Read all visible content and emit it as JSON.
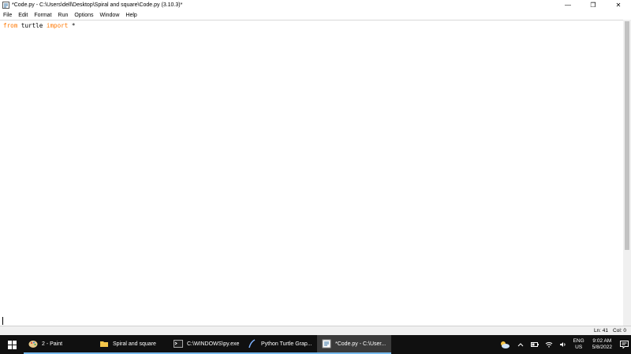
{
  "window": {
    "title": "*Code.py - C:\\Users\\dell\\Desktop\\Spiral and square\\Code.py (3.10.3)*",
    "controls": {
      "minimize": "—",
      "maximize": "❐",
      "close": "✕"
    }
  },
  "menu": [
    "File",
    "Edit",
    "Format",
    "Run",
    "Options",
    "Window",
    "Help"
  ],
  "editor": {
    "line1": {
      "kw1": "from",
      "t1": " turtle ",
      "kw2": "import",
      "t2": " *"
    }
  },
  "status": {
    "line": "Ln: 41",
    "col": "Col: 0"
  },
  "taskbar": {
    "items": [
      {
        "label": "2 - Paint",
        "icon": "paint-icon"
      },
      {
        "label": "Spiral and square",
        "icon": "folder-icon"
      },
      {
        "label": "C:\\WINDOWS\\py.exe",
        "icon": "console-icon"
      },
      {
        "label": "Python Turtle Grap...",
        "icon": "turtle-graphics-icon"
      },
      {
        "label": "*Code.py - C:\\User...",
        "icon": "idle-icon"
      }
    ],
    "lang_line1": "ENG",
    "lang_line2": "US",
    "time": "9:02 AM",
    "date": "5/8/2022"
  },
  "colors": {
    "keyword": "#ff7700",
    "taskbar": "#101010",
    "accent": "#76b9ed"
  }
}
